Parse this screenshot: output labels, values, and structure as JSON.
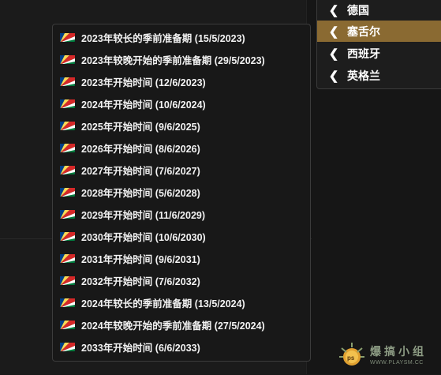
{
  "country_menu": {
    "items": [
      {
        "label": "德国",
        "selected": false
      },
      {
        "label": "塞舌尔",
        "selected": true
      },
      {
        "label": "西班牙",
        "selected": false
      },
      {
        "label": "英格兰",
        "selected": false
      }
    ]
  },
  "season_menu": {
    "flag_icon": "seychelles-flag-icon",
    "items": [
      {
        "label": "2023年较长的季前准备期 (15/5/2023)"
      },
      {
        "label": "2023年较晚开始的季前准备期 (29/5/2023)"
      },
      {
        "label": "2023年开始时间 (12/6/2023)"
      },
      {
        "label": "2024年开始时间 (10/6/2024)"
      },
      {
        "label": "2025年开始时间 (9/6/2025)"
      },
      {
        "label": "2026年开始时间 (8/6/2026)"
      },
      {
        "label": "2027年开始时间 (7/6/2027)"
      },
      {
        "label": "2028年开始时间 (5/6/2028)"
      },
      {
        "label": "2029年开始时间 (11/6/2029)"
      },
      {
        "label": "2030年开始时间 (10/6/2030)"
      },
      {
        "label": "2031年开始时间 (9/6/2031)"
      },
      {
        "label": "2032年开始时间 (7/6/2032)"
      },
      {
        "label": "2024年较长的季前准备期 (13/5/2024)"
      },
      {
        "label": "2024年较晚开始的季前准备期 (27/5/2024)"
      },
      {
        "label": "2033年开始时间 (6/6/2033)"
      }
    ]
  },
  "watermark": {
    "text": "爆搞小组",
    "url": "WWW.PLAYSM.CC",
    "badge": "ps"
  },
  "colors": {
    "selected_bg": "#8a6a32",
    "menu_bg": "#181818",
    "text": "#f2f2f2"
  }
}
